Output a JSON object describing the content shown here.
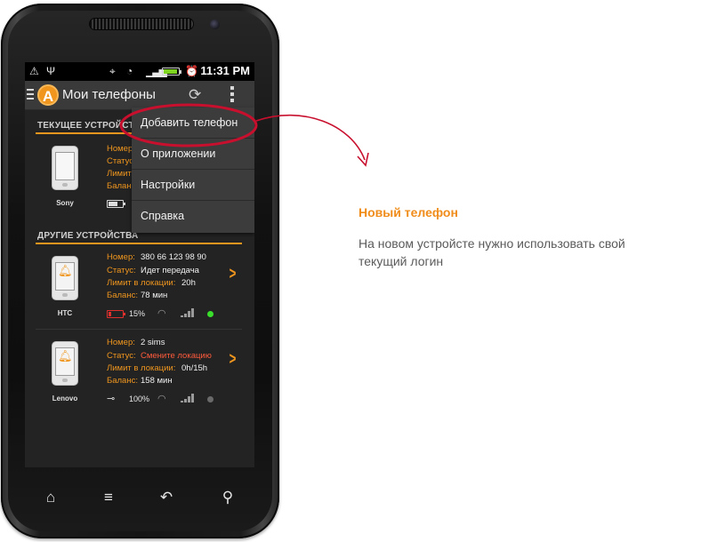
{
  "status_bar": {
    "time": "11:31 PM"
  },
  "action_bar": {
    "logo_letter": "A",
    "title": "Мои телефоны"
  },
  "sections": {
    "current": "ТЕКУЩЕЕ УСТРОЙСТВО",
    "others": "ДРУГИЕ УСТРОЙСТВА"
  },
  "current_device": {
    "name": "Sony",
    "labels": [
      "Номер",
      "Статус",
      "Лимит",
      "Баланс"
    ]
  },
  "devices": [
    {
      "name": "HTC",
      "number_label": "Номер:",
      "number": "380 66 123 98 90",
      "status_label": "Статус:",
      "status": "Идет передача",
      "limit_label": "Лимит в локации:",
      "limit": "20h",
      "balance_label": "Баланс:",
      "balance": "78 мин",
      "battery": "15%",
      "battery_level": 0.15,
      "online_color": "#3adf2c"
    },
    {
      "name": "Lenovo",
      "number_label": "Номер:",
      "number": "2 sims",
      "status_label": "Статус:",
      "status": "Смените локацию",
      "limit_label": "Лимит в локации:",
      "limit": "0h/15h",
      "balance_label": "Баланс:",
      "balance": "158 мин",
      "battery": "100%",
      "online_color": "#6a6a6a"
    }
  ],
  "menu": {
    "items": [
      "Добавить телефон",
      "О приложении",
      "Настройки",
      "Справка"
    ]
  },
  "icons": {
    "home": "home-icon",
    "menu": "menu-icon",
    "back": "back-icon",
    "search": "search-icon",
    "refresh": "refresh-icon",
    "more": "overflow-icon"
  },
  "colors": {
    "accent": "#f0961e",
    "annotation_red": "#c8102e",
    "low_battery": "#e0302e"
  },
  "annotation": {
    "title": "Новый телефон",
    "text": "На новом устройсте нужно использовать свой текущий логин"
  }
}
